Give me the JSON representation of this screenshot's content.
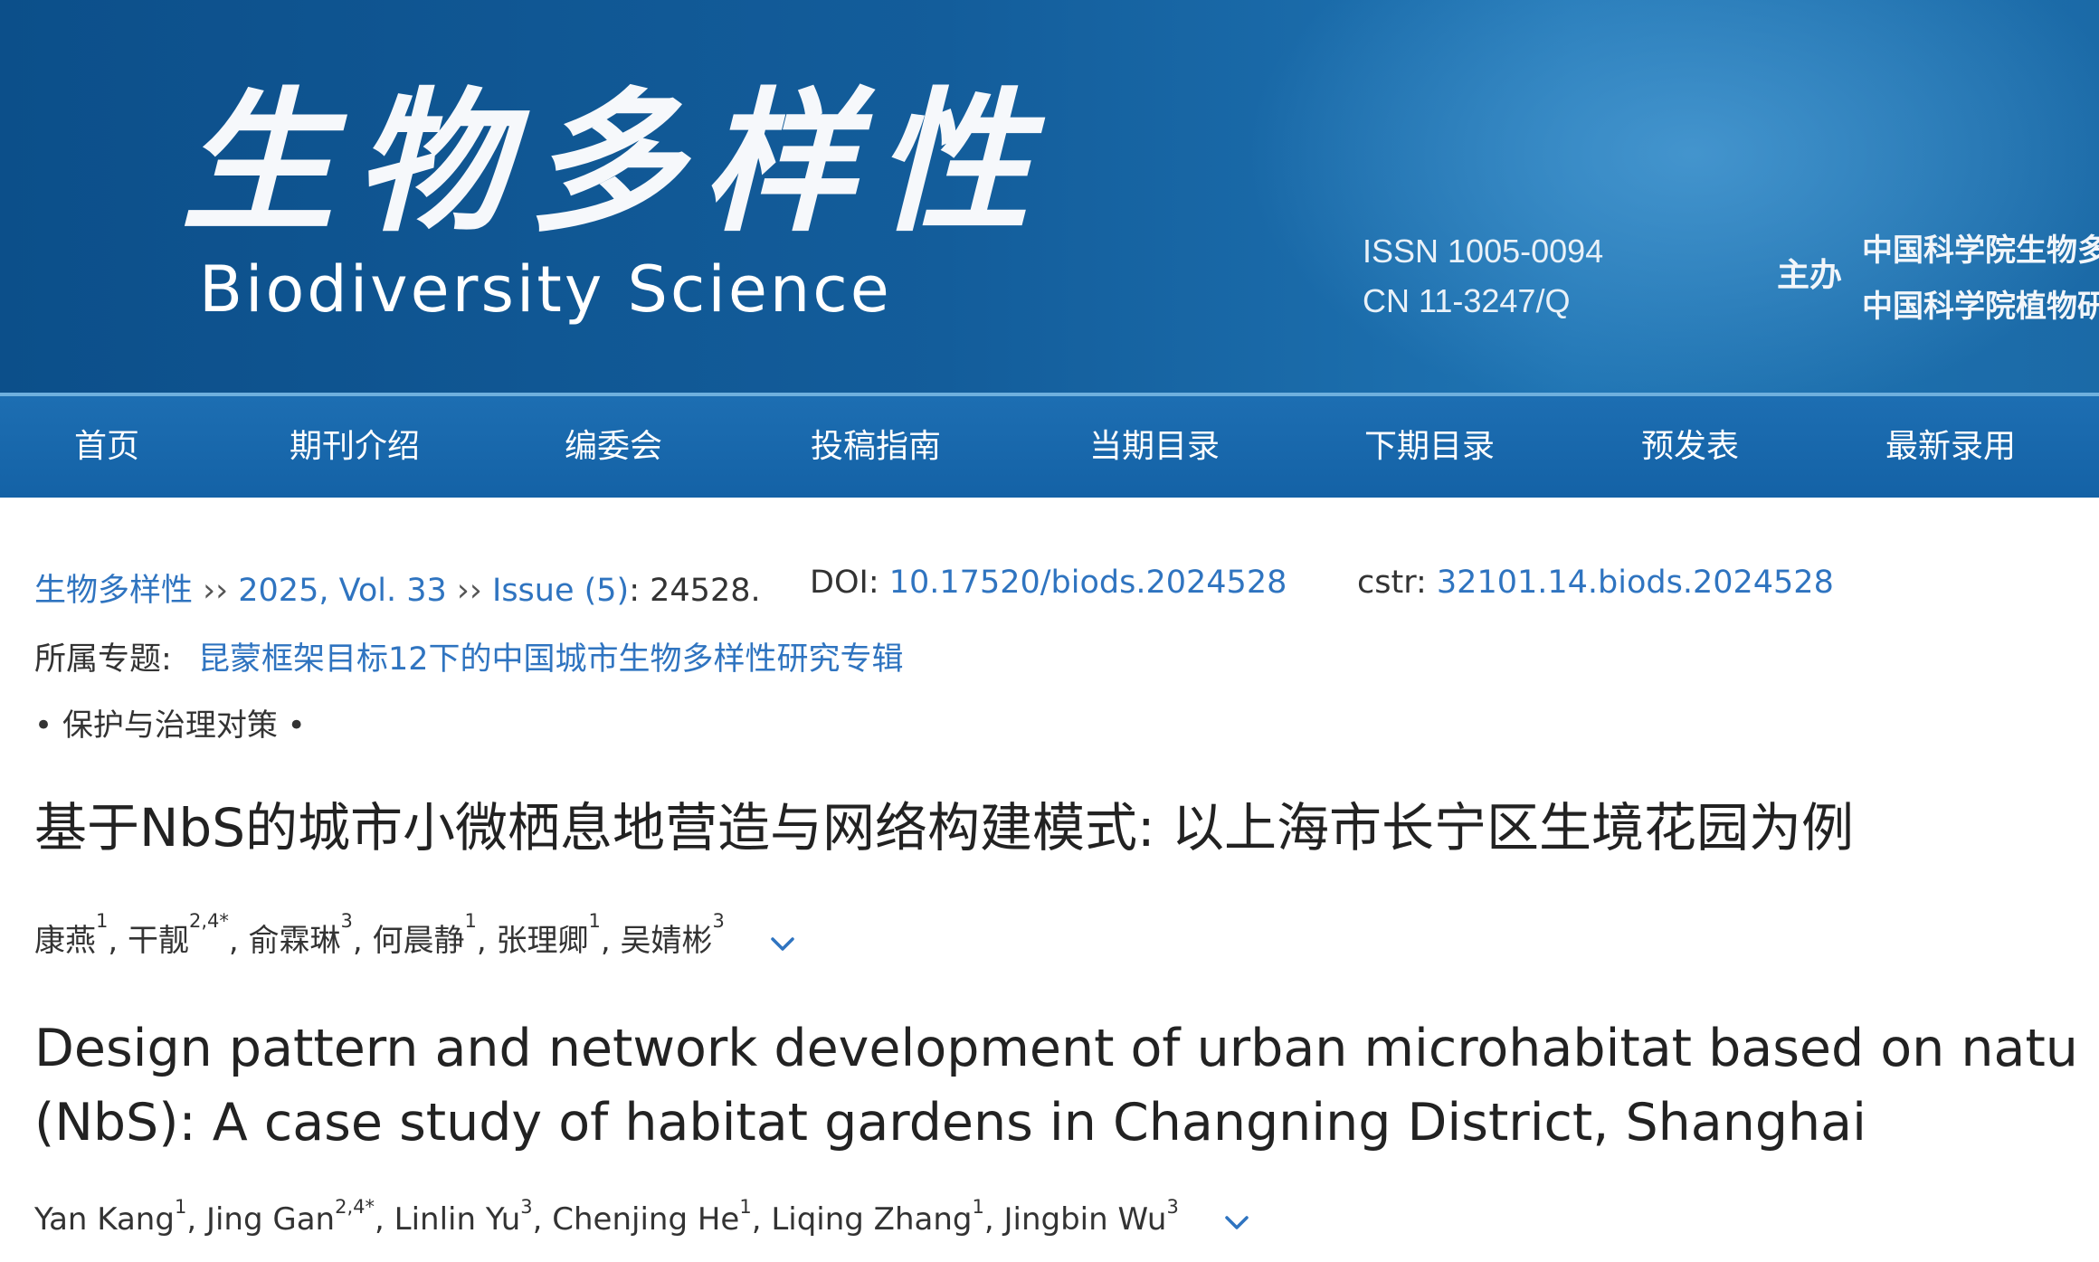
{
  "header": {
    "logo_cn": "生物多样性",
    "logo_en": "Biodiversity Science",
    "issn": "ISSN 1005-0094",
    "cn": "CN 11-3247/Q",
    "sponsor_label": "主办",
    "sponsor_1": "中国科学院生物多",
    "sponsor_2": "中国科学院植物研"
  },
  "nav": {
    "items": [
      "首页",
      "期刊介绍",
      "编委会",
      "投稿指南",
      "当期目录",
      "下期目录",
      "预发表",
      "最新录用"
    ]
  },
  "breadcrumb": {
    "journal": "生物多样性",
    "sep": " ›› ",
    "volume": "2025, Vol. 33",
    "issue": "Issue (5)",
    "article_no": ": 24528.",
    "doi_label": "DOI: ",
    "doi": "10.17520/biods.2024528",
    "cstr_label": "cstr: ",
    "cstr": "32101.14.biods.2024528"
  },
  "topic": {
    "label": "所属专题:",
    "value": "昆蒙框架目标12下的中国城市生物多样性研究专辑"
  },
  "section": "• 保护与治理对策 •",
  "title_cn": "基于NbS的城市小微栖息地营造与网络构建模式: 以上海市长宁区生境花园为例",
  "authors_cn": [
    {
      "name": "康燕",
      "sup": "1"
    },
    {
      "name": "干靓",
      "sup": "2,4*"
    },
    {
      "name": "俞霖琳",
      "sup": "3"
    },
    {
      "name": "何晨静",
      "sup": "1"
    },
    {
      "name": "张理卿",
      "sup": "1"
    },
    {
      "name": "吴婧彬",
      "sup": "3"
    }
  ],
  "title_en_line1": "Design pattern and network development of urban microhabitat based on natu",
  "title_en_line2": "(NbS): A case study of habitat gardens in Changning District, Shanghai",
  "authors_en": [
    {
      "name": "Yan Kang",
      "sup": "1"
    },
    {
      "name": "Jing Gan",
      "sup": "2,4*"
    },
    {
      "name": "Linlin Yu",
      "sup": "3"
    },
    {
      "name": "Chenjing He",
      "sup": "1"
    },
    {
      "name": "Liqing Zhang",
      "sup": "1"
    },
    {
      "name": "Jingbin Wu",
      "sup": "3"
    }
  ],
  "icons": {
    "expand_authors": "chevron-down-icon"
  },
  "colors": {
    "banner": "#135d9b",
    "nav": "#1a69ad",
    "link": "#2f74c0"
  }
}
